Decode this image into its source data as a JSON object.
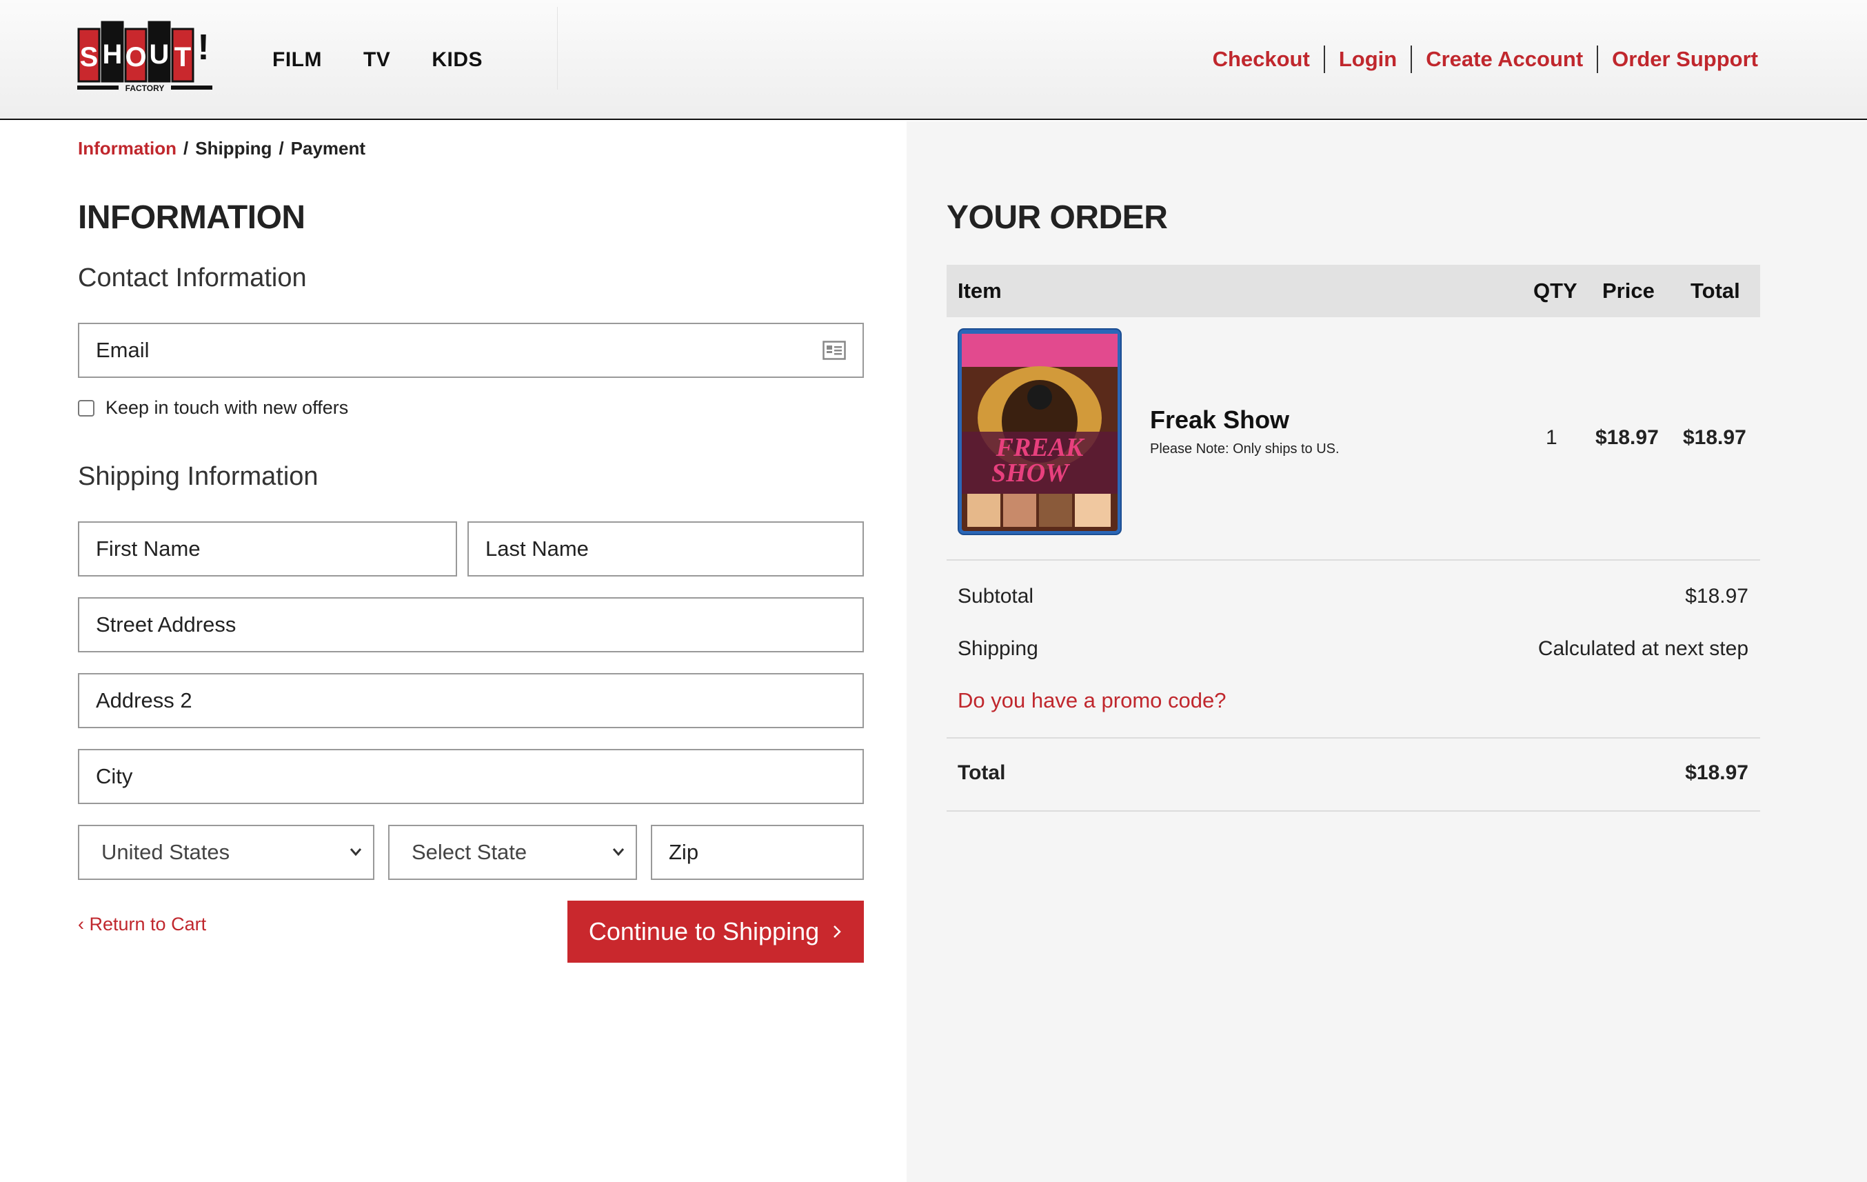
{
  "header": {
    "logo_alt": "SHOUT! FACTORY",
    "nav_main": [
      "FILM",
      "TV",
      "KIDS"
    ],
    "nav_right": [
      "Checkout",
      "Login",
      "Create Account",
      "Order Support"
    ]
  },
  "breadcrumb": {
    "active": "Information",
    "sep": "/",
    "step2": "Shipping",
    "step3": "Payment"
  },
  "form": {
    "title": "INFORMATION",
    "contact_heading": "Contact Information",
    "email_placeholder": "Email",
    "keep_in_touch": "Keep in touch with new offers",
    "shipping_heading": "Shipping Information",
    "first_name": "First Name",
    "last_name": "Last Name",
    "street": "Street Address",
    "address2": "Address 2",
    "city": "City",
    "country": "United States",
    "state": "Select State",
    "zip": "Zip",
    "return_link": "Return to Cart",
    "continue_label": "Continue to Shipping"
  },
  "order": {
    "title": "YOUR ORDER",
    "columns": [
      "Item",
      "QTY",
      "Price",
      "Total"
    ],
    "item": {
      "name": "Freak Show",
      "note": "Please Note: Only ships to US.",
      "cover_title": "FREAK SHOW",
      "qty": "1",
      "price": "$18.97",
      "total": "$18.97"
    },
    "subtotal_label": "Subtotal",
    "subtotal_value": "$18.97",
    "shipping_label": "Shipping",
    "shipping_value": "Calculated at next step",
    "promo_link": "Do you have a promo code?",
    "total_label": "Total",
    "total_value": "$18.97"
  },
  "colors": {
    "accent": "#c0272d",
    "button": "#c9282d",
    "panel": "#f5f5f5"
  }
}
